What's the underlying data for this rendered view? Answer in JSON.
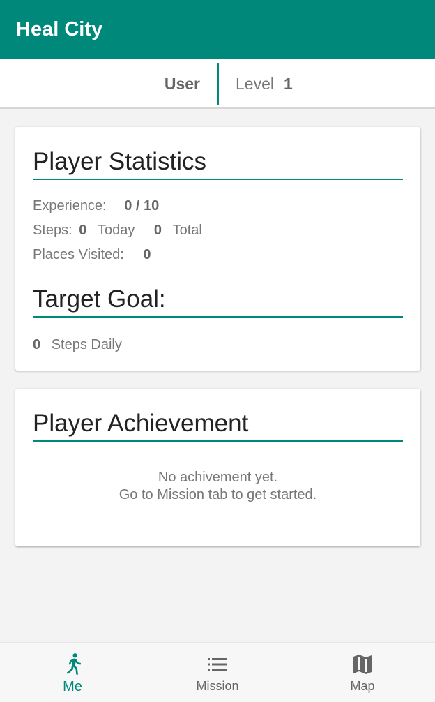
{
  "app": {
    "title": "Heal City"
  },
  "user_bar": {
    "user_label": "User",
    "level_label": "Level",
    "level_value": "1"
  },
  "stats_card": {
    "title": "Player Statistics",
    "experience_label": "Experience:",
    "experience_value": "0 / 10",
    "steps_label": "Steps:",
    "steps_today_value": "0",
    "steps_today_label": "Today",
    "steps_total_value": "0",
    "steps_total_label": "Total",
    "places_label": "Places Visited:",
    "places_value": "0",
    "goal_title": "Target Goal:",
    "goal_value": "0",
    "goal_label": "Steps Daily"
  },
  "achievement_card": {
    "title": "Player Achievement",
    "empty_line1": "No achivement yet.",
    "empty_line2": "Go to Mission tab to get started."
  },
  "bottom_nav": {
    "items": [
      {
        "label": "Me",
        "icon": "runner-icon",
        "active": true
      },
      {
        "label": "Mission",
        "icon": "list-icon",
        "active": false
      },
      {
        "label": "Map",
        "icon": "map-icon",
        "active": false
      }
    ]
  },
  "colors": {
    "primary": "#00897b",
    "background": "#f3f3f3"
  }
}
